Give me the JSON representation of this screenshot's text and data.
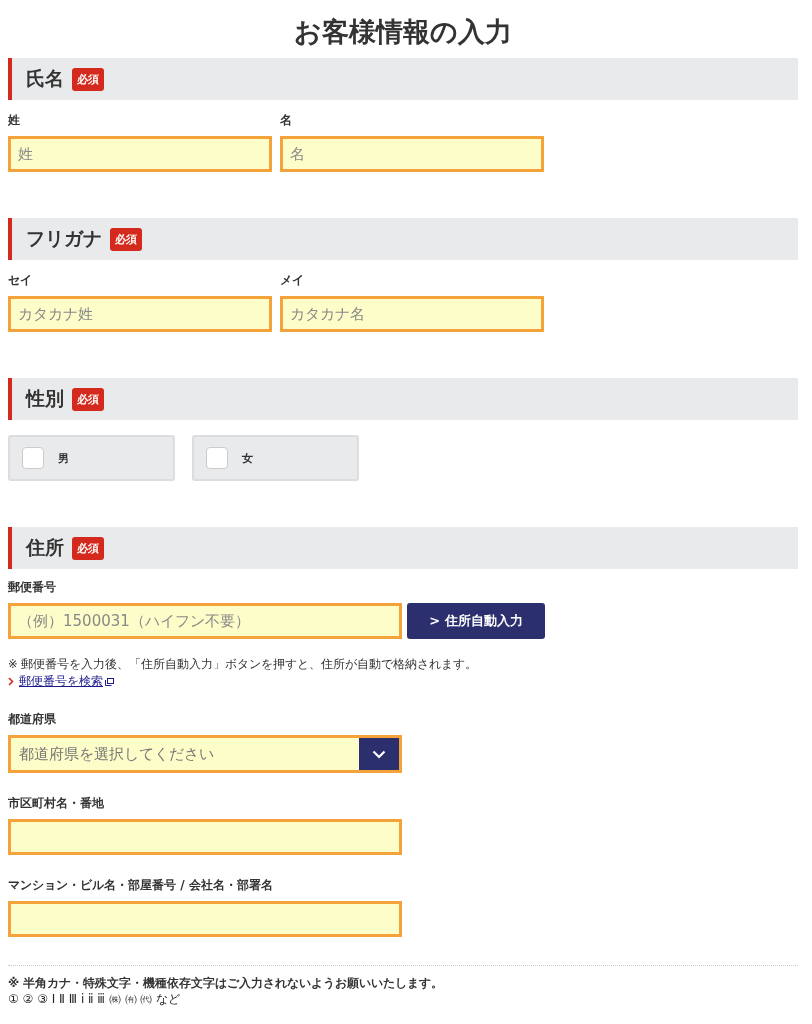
{
  "title": "お客様情報の入力",
  "sections": [
    {
      "heading": "氏名",
      "badge": "必須",
      "kind": "pair",
      "fields": [
        {
          "label": "姓",
          "placeholder": "姓"
        },
        {
          "label": "名",
          "placeholder": "名"
        }
      ]
    },
    {
      "heading": "フリガナ",
      "badge": "必須",
      "kind": "pair",
      "fields": [
        {
          "label": "セイ",
          "placeholder": "カタカナ姓"
        },
        {
          "label": "メイ",
          "placeholder": "カタカナ名"
        }
      ]
    },
    {
      "heading": "性別",
      "badge": "必須",
      "kind": "choices",
      "options": [
        {
          "label": "男",
          "checked": false
        },
        {
          "label": "女",
          "checked": false
        }
      ]
    },
    {
      "heading": "住所",
      "badge": "必須",
      "kind": "address",
      "rows": [
        {
          "kind": "postal",
          "label": "郵便番号",
          "placeholder": "（例）1500031（ハイフン不要）",
          "button": "> 住所自動入力",
          "note": "※ 郵便番号を入力後、「住所自動入力」ボタンを押すと、住所が自動で格納されます。",
          "link": "郵便番号を検索"
        },
        {
          "kind": "select",
          "label": "都道府県",
          "placeholder": "都道府県を選択してください"
        },
        {
          "kind": "text",
          "label": "市区町村名・番地"
        },
        {
          "kind": "text",
          "label": "マンション・ビル名・部屋番号 / 会社名・部署名"
        }
      ]
    }
  ],
  "footnote": {
    "text": "※ 半角カナ・特殊文字・機種依存文字はご入力されないようお願いいたします。",
    "examples": "① ② ③ Ⅰ Ⅱ Ⅲ ⅰ ⅱ ⅲ ㈱ ㈲ ㈹ など"
  }
}
